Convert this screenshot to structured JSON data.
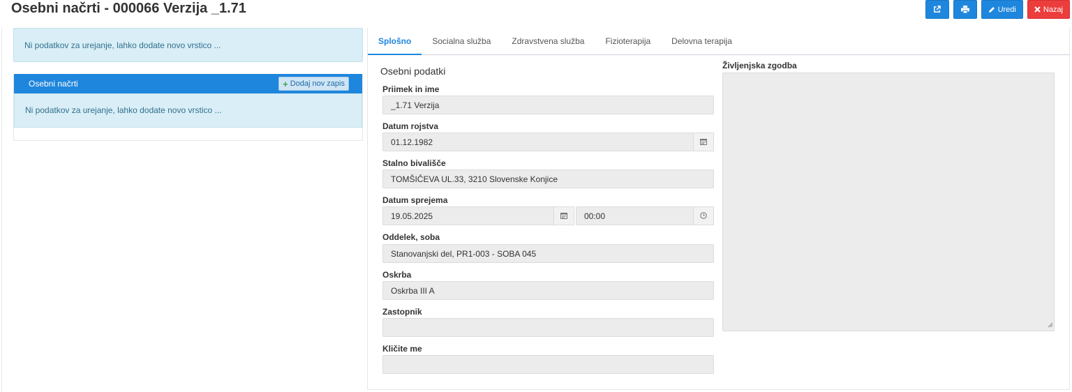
{
  "page": {
    "title": "Osebni načrti - 000066 Verzija _1.71"
  },
  "toolbar": {
    "edit_label": "Uredi",
    "back_label": "Nazaj",
    "colors": {
      "primary": "#1f86dd",
      "danger": "#ec3d3d"
    }
  },
  "left": {
    "info_text": "Ni podatkov za urejanje, lahko dodate novo vrstico ...",
    "panel": {
      "title": "Osebni načrti",
      "add_label": "Dodaj nov zapis",
      "info_text": "Ni podatkov za urejanje, lahko dodate novo vrstico ..."
    }
  },
  "tabs": [
    {
      "label": "Splošno",
      "active": true
    },
    {
      "label": "Socialna služba",
      "active": false
    },
    {
      "label": "Zdravstvena služba",
      "active": false
    },
    {
      "label": "Fizioterapija",
      "active": false
    },
    {
      "label": "Delovna terapija",
      "active": false
    }
  ],
  "form": {
    "section_title": "Osebni podatki",
    "name_label": "Priimek in ime",
    "name_value": "_1.71 Verzija",
    "birth_label": "Datum rojstva",
    "birth_value": "01.12.1982",
    "address_label": "Stalno bivališče",
    "address_value": "TOMŠIČEVA UL.33, 3210 Slovenske Konjice",
    "admission_label": "Datum sprejema",
    "admission_date": "19.05.2025",
    "admission_time": "00:00",
    "dept_label": "Oddelek, soba",
    "dept_value": "Stanovanjski del, PR1-003 - SOBA 045",
    "care_label": "Oskrba",
    "care_value": "Oskrba III A",
    "rep_label": "Zastopnik",
    "rep_value": "",
    "call_label": "Kličite me",
    "call_value": "",
    "life_label": "Življenjska zgodba"
  }
}
